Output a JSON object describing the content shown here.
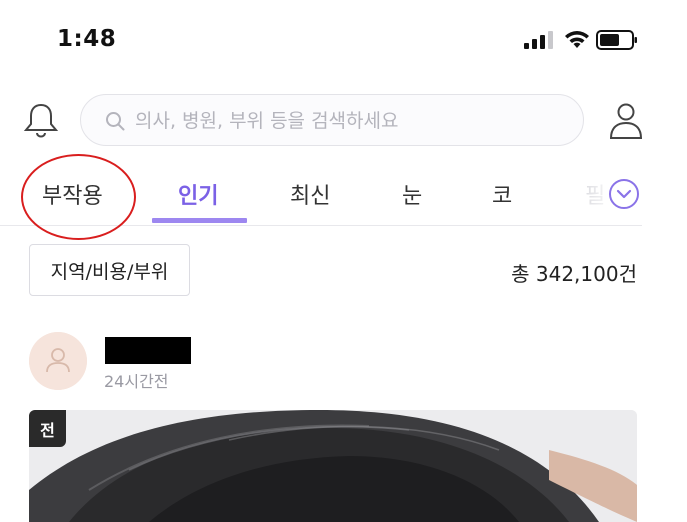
{
  "status_bar": {
    "time": "1:48"
  },
  "header": {
    "search": {
      "placeholder": "의사, 병원, 부위 등을 검색하세요",
      "value": ""
    }
  },
  "tabs": [
    {
      "label": "부작용"
    },
    {
      "label": "인기",
      "active": true
    },
    {
      "label": "최신"
    },
    {
      "label": "눈"
    },
    {
      "label": "코"
    },
    {
      "label": "필"
    }
  ],
  "filter": {
    "label": "지역/비용/부위"
  },
  "total": "총 342,100건",
  "post": {
    "time": "24시간전",
    "badge": "전"
  },
  "colors": {
    "accent": "#7b61e6",
    "accent_light": "#9d87f0",
    "annotation_circle": "#d91e1e",
    "avatar_bg": "#f6e4dc"
  }
}
